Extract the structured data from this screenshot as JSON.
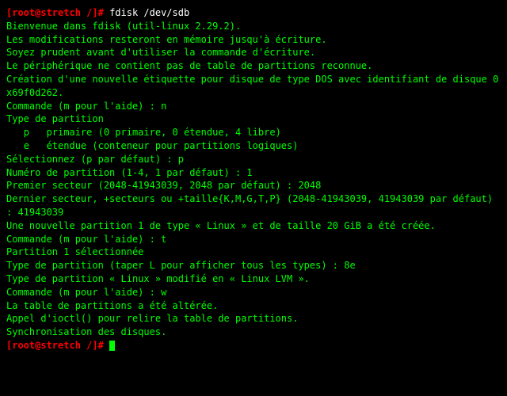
{
  "prompt": {
    "user_host": "[root@stretch /]",
    "symbol": "#"
  },
  "command1": "fdisk /dev/sdb",
  "lines": {
    "l0": "",
    "l1": "Bienvenue dans fdisk (util-linux 2.29.2).",
    "l2": "Les modifications resteront en mémoire jusqu'à écriture.",
    "l3": "Soyez prudent avant d'utiliser la commande d'écriture.",
    "l4": "",
    "l5": "Le périphérique ne contient pas de table de partitions reconnue.",
    "l6": "Création d'une nouvelle étiquette pour disque de type DOS avec identifiant de disque 0x69f0d262.",
    "l7": "",
    "l8": "Commande (m pour l'aide) : n",
    "l9": "Type de partition",
    "l10": "   p   primaire (0 primaire, 0 étendue, 4 libre)",
    "l11": "   e   étendue (conteneur pour partitions logiques)",
    "l12": "Sélectionnez (p par défaut) : p",
    "l13": "Numéro de partition (1-4, 1 par défaut) : 1",
    "l14": "Premier secteur (2048-41943039, 2048 par défaut) : 2048",
    "l15": "Dernier secteur, +secteurs ou +taille{K,M,G,T,P} (2048-41943039, 41943039 par défaut) : 41943039",
    "l16": "",
    "l17": "Une nouvelle partition 1 de type « Linux » et de taille 20 GiB a été créée.",
    "l18": "",
    "l19": "Commande (m pour l'aide) : t",
    "l20": "Partition 1 sélectionnée",
    "l21": "Type de partition (taper L pour afficher tous les types) : 8e",
    "l22": "Type de partition « Linux » modifié en « Linux LVM ».",
    "l23": "",
    "l24": "Commande (m pour l'aide) : w",
    "l25": "La table de partitions a été altérée.",
    "l26": "Appel d'ioctl() pour relire la table de partitions.",
    "l27": "Synchronisation des disques.",
    "l28": ""
  }
}
